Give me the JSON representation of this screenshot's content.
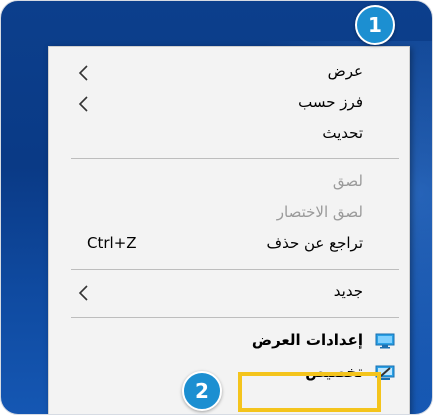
{
  "menu": {
    "items": [
      {
        "label": "عرض",
        "has_submenu": true,
        "disabled": false
      },
      {
        "label": "فرز حسب",
        "has_submenu": true,
        "disabled": false
      },
      {
        "label": "تحديث",
        "has_submenu": false,
        "disabled": false
      },
      {
        "label": "لصق",
        "has_submenu": false,
        "disabled": true
      },
      {
        "label": "لصق الاختصار",
        "has_submenu": false,
        "disabled": true
      },
      {
        "label": "تراجع عن حذف",
        "shortcut": "Ctrl+Z",
        "disabled": false
      },
      {
        "label": "جديد",
        "has_submenu": true,
        "disabled": false
      },
      {
        "label": "إعدادات العرض",
        "icon": "display-settings-icon",
        "disabled": false
      },
      {
        "label": "تخصيص",
        "icon": "personalize-icon",
        "disabled": false
      }
    ]
  },
  "badges": {
    "first": "1",
    "second": "2"
  },
  "colors": {
    "badge": "#1c8fd1",
    "highlight": "#f4c41c",
    "desktop": "#0c3f8c",
    "menu_bg": "#f3f3f3"
  }
}
